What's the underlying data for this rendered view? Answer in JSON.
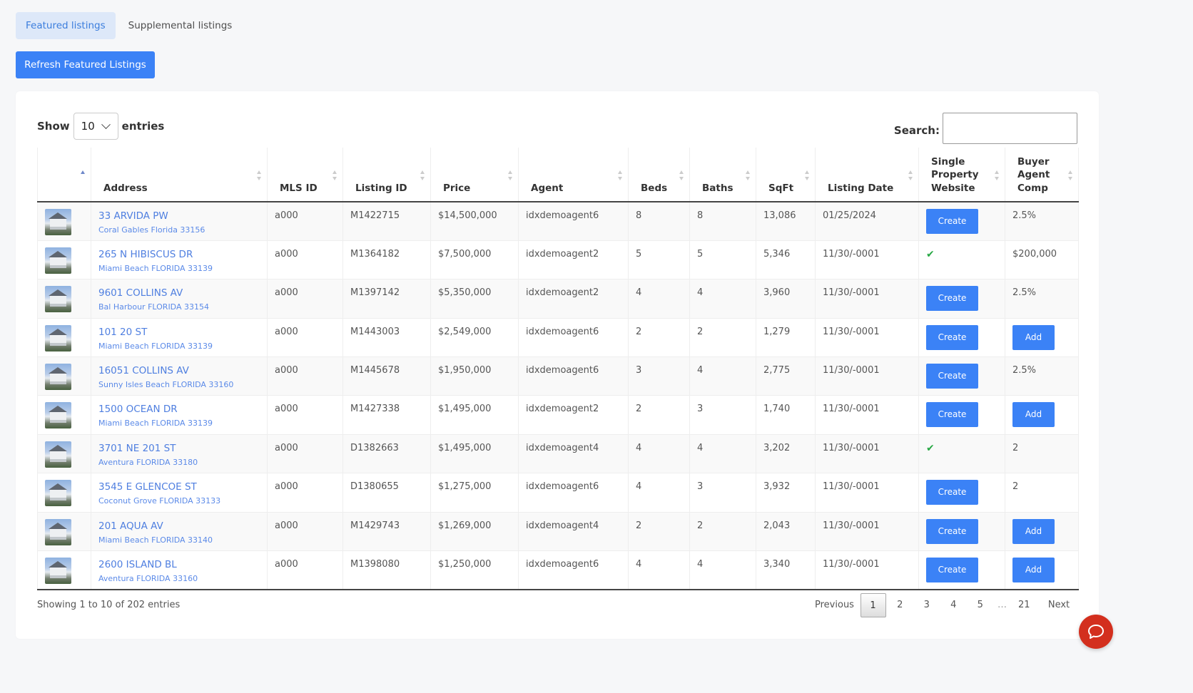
{
  "tabs": [
    {
      "label": "Featured listings",
      "active": true
    },
    {
      "label": "Supplemental listings",
      "active": false
    }
  ],
  "refresh_label": "Refresh Featured Listings",
  "controls": {
    "show_label": "Show",
    "entries_label": "entries",
    "page_size": "10",
    "search_label": "Search:",
    "search_value": ""
  },
  "columns": [
    {
      "label": "",
      "sorted": "asc"
    },
    {
      "label": "Address"
    },
    {
      "label": "MLS ID"
    },
    {
      "label": "Listing ID"
    },
    {
      "label": "Price"
    },
    {
      "label": "Agent"
    },
    {
      "label": "Beds"
    },
    {
      "label": "Baths"
    },
    {
      "label": "SqFt"
    },
    {
      "label": "Listing Date"
    },
    {
      "label": "Single Property Website"
    },
    {
      "label": "Buyer Agent Comp"
    }
  ],
  "rows": [
    {
      "address": "33 ARVIDA PW",
      "city": "Coral Gables Florida 33156",
      "mls_id": "a000",
      "listing_id": "M1422715",
      "price": "$14,500,000",
      "agent": "idxdemoagent6",
      "beds": "8",
      "baths": "8",
      "sqft": "13,086",
      "date": "01/25/2024",
      "website": "Create",
      "comp": "2.5%"
    },
    {
      "address": "265 N HIBISCUS DR",
      "city": "Miami Beach FLORIDA 33139",
      "mls_id": "a000",
      "listing_id": "M1364182",
      "price": "$7,500,000",
      "agent": "idxdemoagent2",
      "beds": "5",
      "baths": "5",
      "sqft": "5,346",
      "date": "11/30/-0001",
      "website": "check",
      "comp": "$200,000"
    },
    {
      "address": "9601 COLLINS AV",
      "city": "Bal Harbour FLORIDA 33154",
      "mls_id": "a000",
      "listing_id": "M1397142",
      "price": "$5,350,000",
      "agent": "idxdemoagent2",
      "beds": "4",
      "baths": "4",
      "sqft": "3,960",
      "date": "11/30/-0001",
      "website": "Create",
      "comp": "2.5%"
    },
    {
      "address": "101 20 ST",
      "city": "Miami Beach FLORIDA 33139",
      "mls_id": "a000",
      "listing_id": "M1443003",
      "price": "$2,549,000",
      "agent": "idxdemoagent6",
      "beds": "2",
      "baths": "2",
      "sqft": "1,279",
      "date": "11/30/-0001",
      "website": "Create",
      "comp": "Add"
    },
    {
      "address": "16051 COLLINS AV",
      "city": "Sunny Isles Beach FLORIDA 33160",
      "mls_id": "a000",
      "listing_id": "M1445678",
      "price": "$1,950,000",
      "agent": "idxdemoagent6",
      "beds": "3",
      "baths": "4",
      "sqft": "2,775",
      "date": "11/30/-0001",
      "website": "Create",
      "comp": "2.5%"
    },
    {
      "address": "1500 OCEAN DR",
      "city": "Miami Beach FLORIDA 33139",
      "mls_id": "a000",
      "listing_id": "M1427338",
      "price": "$1,495,000",
      "agent": "idxdemoagent2",
      "beds": "2",
      "baths": "3",
      "sqft": "1,740",
      "date": "11/30/-0001",
      "website": "Create",
      "comp": "Add"
    },
    {
      "address": "3701 NE 201 ST",
      "city": "Aventura FLORIDA 33180",
      "mls_id": "a000",
      "listing_id": "D1382663",
      "price": "$1,495,000",
      "agent": "idxdemoagent4",
      "beds": "4",
      "baths": "4",
      "sqft": "3,202",
      "date": "11/30/-0001",
      "website": "check",
      "comp": "2"
    },
    {
      "address": "3545 E GLENCOE ST",
      "city": "Coconut Grove FLORIDA 33133",
      "mls_id": "a000",
      "listing_id": "D1380655",
      "price": "$1,275,000",
      "agent": "idxdemoagent6",
      "beds": "4",
      "baths": "3",
      "sqft": "3,932",
      "date": "11/30/-0001",
      "website": "Create",
      "comp": "2"
    },
    {
      "address": "201 AQUA AV",
      "city": "Miami Beach FLORIDA 33140",
      "mls_id": "a000",
      "listing_id": "M1429743",
      "price": "$1,269,000",
      "agent": "idxdemoagent4",
      "beds": "2",
      "baths": "2",
      "sqft": "2,043",
      "date": "11/30/-0001",
      "website": "Create",
      "comp": "Add"
    },
    {
      "address": "2600 ISLAND BL",
      "city": "Aventura FLORIDA 33160",
      "mls_id": "a000",
      "listing_id": "M1398080",
      "price": "$1,250,000",
      "agent": "idxdemoagent6",
      "beds": "4",
      "baths": "4",
      "sqft": "3,340",
      "date": "11/30/-0001",
      "website": "Create",
      "comp": "Add"
    }
  ],
  "info": "Showing 1 to 10 of 202 entries",
  "pagination": {
    "previous": "Previous",
    "pages": [
      "1",
      "2",
      "3",
      "4",
      "5"
    ],
    "ellipsis": "…",
    "last": "21",
    "next": "Next",
    "current": "1"
  },
  "colors": {
    "accent": "#3b82f6",
    "link": "#4f7fe0",
    "check": "#27a844",
    "chat_fab": "#d32f1e"
  },
  "icons": {
    "page_size_dropdown": "chevron-down-icon",
    "website_done": "check-icon",
    "chat": "chat-bubble-icon"
  }
}
